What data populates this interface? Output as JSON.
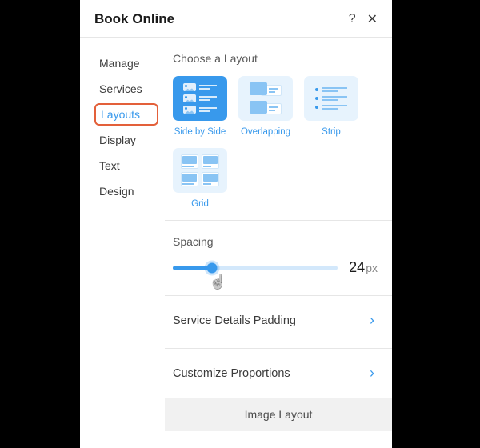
{
  "header": {
    "title": "Book Online",
    "help_glyph": "?",
    "close_glyph": "✕"
  },
  "sidebar": {
    "items": [
      {
        "label": "Manage",
        "selected": false
      },
      {
        "label": "Services",
        "selected": false
      },
      {
        "label": "Layouts",
        "selected": true
      },
      {
        "label": "Display",
        "selected": false
      },
      {
        "label": "Text",
        "selected": false
      },
      {
        "label": "Design",
        "selected": false
      }
    ]
  },
  "layouts": {
    "section_title": "Choose a Layout",
    "options": [
      {
        "label": "Side by Side",
        "selected": true
      },
      {
        "label": "Overlapping",
        "selected": false
      },
      {
        "label": "Strip",
        "selected": false
      },
      {
        "label": "Grid",
        "selected": false
      }
    ]
  },
  "spacing": {
    "title": "Spacing",
    "value": "24",
    "unit": "px",
    "percent": 24
  },
  "rows": {
    "service_details_padding": "Service Details Padding",
    "customize_proportions": "Customize Proportions"
  },
  "footer": {
    "label": "Image Layout"
  },
  "colors": {
    "primary": "#3899ec",
    "highlight_border": "#e3603a"
  }
}
